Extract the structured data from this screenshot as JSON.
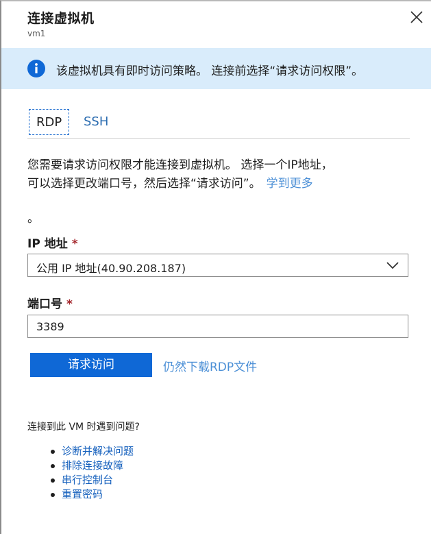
{
  "header": {
    "title": "连接虚拟机",
    "subtitle": "vm1",
    "close_icon": "close-icon"
  },
  "banner": {
    "icon": "info-icon",
    "text": "该虚拟机具有即时访问策略。 连接前选择“请求访问权限”。",
    "background": "#d9ecfb",
    "icon_color": "#0f68d6"
  },
  "tabs": [
    {
      "label": "RDP",
      "selected": true
    },
    {
      "label": "SSH",
      "selected": false
    }
  ],
  "description": {
    "line1": "您需要请求访问权限才能连接到虚拟机。 选择一个IP地址，",
    "line2": "可以选择更改端口号，然后选择“请求访问”。",
    "learn_more": "学到更多",
    "trailing": "。"
  },
  "ip_field": {
    "label": "IP 地址",
    "required_mark": "*",
    "selected_value": "公用 IP 地址(40.90.208.187)",
    "chevron_icon": "chevron-down-icon"
  },
  "port_field": {
    "label": "端口号",
    "required_mark": "*",
    "value": "3389"
  },
  "actions": {
    "request_button": "请求访问",
    "download_link": "仍然下载RDP文件",
    "primary_color": "#0f68d6"
  },
  "troubleshoot": {
    "heading": "连接到此 VM 时遇到问题?",
    "items": [
      "诊断并解决问题",
      "排除连接故障",
      "串行控制台",
      "重置密码"
    ]
  }
}
